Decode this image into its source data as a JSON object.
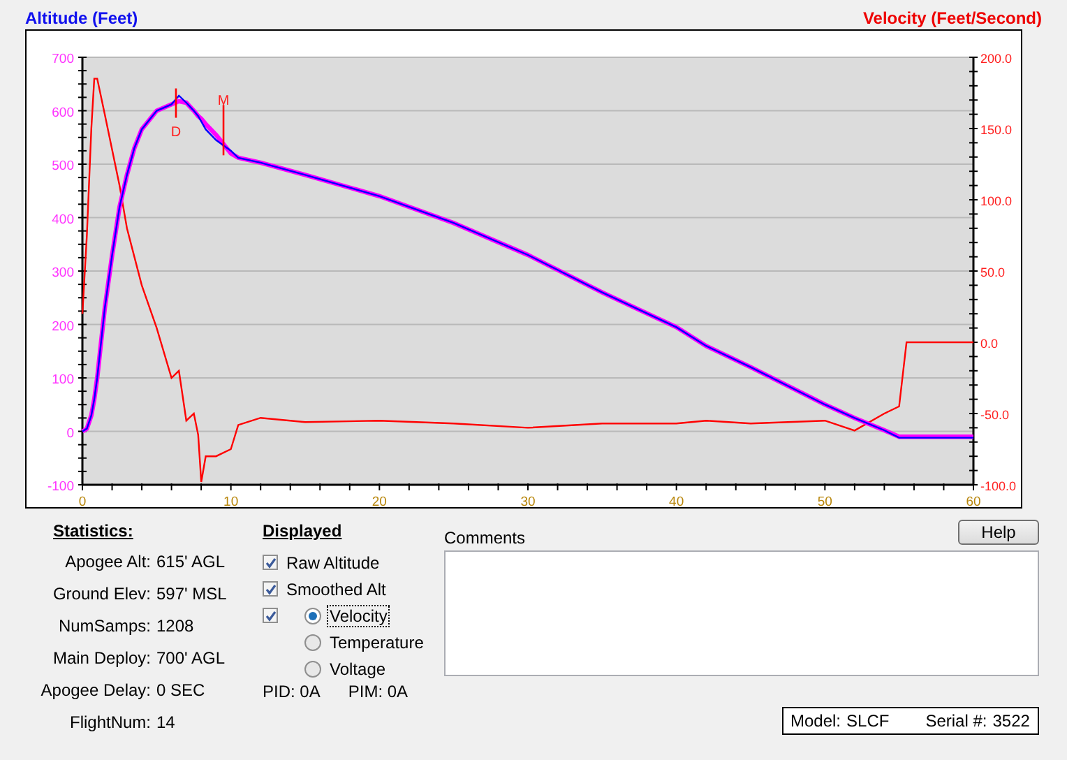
{
  "header": {
    "left_title": "Altitude (Feet)",
    "right_title": "Velocity (Feet/Second)"
  },
  "chart_data": {
    "type": "line",
    "x": [
      0,
      0.3,
      0.6,
      0.8,
      1,
      1.5,
      2,
      2.5,
      3,
      3.5,
      4,
      5,
      6,
      6.5,
      7,
      7.5,
      7.8,
      8,
      8.3,
      9,
      10,
      10.5,
      12,
      15,
      20,
      25,
      30,
      35,
      40,
      42,
      45,
      50,
      52,
      54,
      55,
      55.5,
      60
    ],
    "xlim": [
      0,
      60
    ],
    "ylim": [
      -100,
      700
    ],
    "y2lim": [
      -100,
      200
    ],
    "xticks": [
      0,
      10,
      20,
      30,
      40,
      50,
      60
    ],
    "yticks": [
      -100,
      0,
      100,
      200,
      300,
      400,
      500,
      600,
      700
    ],
    "y2ticks": [
      {
        "value": -100,
        "label": "-100.0"
      },
      {
        "value": -50,
        "label": "-50.0"
      },
      {
        "value": 0,
        "label": "0.0"
      },
      {
        "value": 50,
        "label": "50.0"
      },
      {
        "value": 100,
        "label": "100.0"
      },
      {
        "value": 150,
        "label": "150.0"
      },
      {
        "value": 200,
        "label": "200.0"
      }
    ],
    "series": [
      {
        "name": "Raw Altitude",
        "color": "#0000ff",
        "values": [
          0,
          5,
          30,
          60,
          100,
          230,
          330,
          420,
          480,
          530,
          565,
          600,
          612,
          628,
          615,
          600,
          590,
          580,
          565,
          545,
          525,
          512,
          503,
          480,
          440,
          390,
          330,
          260,
          195,
          160,
          120,
          50,
          25,
          2,
          -12,
          -12,
          -12
        ]
      },
      {
        "name": "Smoothed Alt",
        "color": "#ff00ff",
        "values": [
          0,
          5,
          30,
          60,
          100,
          230,
          330,
          420,
          480,
          530,
          565,
          600,
          612,
          618,
          615,
          600,
          590,
          585,
          575,
          555,
          520,
          512,
          503,
          480,
          440,
          390,
          330,
          260,
          195,
          160,
          120,
          50,
          25,
          2,
          -10,
          -10,
          -10
        ]
      },
      {
        "name": "Velocity",
        "color": "#ff0000",
        "axis": "y2",
        "values": [
          20,
          75,
          150,
          185,
          185,
          160,
          135,
          110,
          80,
          60,
          40,
          10,
          -25,
          -20,
          -55,
          -50,
          -65,
          -98,
          -80,
          -80,
          -75,
          -58,
          -53,
          -56,
          -55,
          -57,
          -60,
          -57,
          -57,
          -55,
          -57,
          -55,
          -62,
          -50,
          -45,
          0,
          0
        ]
      }
    ],
    "grid": true,
    "annotations": [
      "D",
      "M"
    ]
  },
  "statistics": {
    "title": "Statistics:",
    "rows": [
      {
        "label": "Apogee Alt:",
        "value": "615' AGL"
      },
      {
        "label": "Ground Elev:",
        "value": "597' MSL"
      },
      {
        "label": "NumSamps:",
        "value": "1208"
      },
      {
        "label": "Main Deploy:",
        "value": "700' AGL"
      },
      {
        "label": "Apogee Delay:",
        "value": "0 SEC"
      },
      {
        "label": "FlightNum:",
        "value": "14"
      }
    ]
  },
  "displayed": {
    "title": "Displayed",
    "items": [
      {
        "kind": "checkbox",
        "checked": true
      },
      {
        "kind": "checkbox",
        "checked": true
      },
      {
        "kind": "check-radio",
        "checked": true,
        "selected": true,
        "focused": true
      },
      {
        "kind": "radio",
        "label": "Temperature",
        "selected": false
      },
      {
        "kind": "radio",
        "label": "Voltage",
        "selected": false
      }
    ],
    "pid": "PID: 0A",
    "pim": "PIM: 0A"
  },
  "comments": {
    "label": "Comments"
  },
  "help_button": "Help",
  "info": {
    "model_label": "Model:",
    "model": "SLCF",
    "serial_label": "Serial #:",
    "serial": "3522"
  }
}
